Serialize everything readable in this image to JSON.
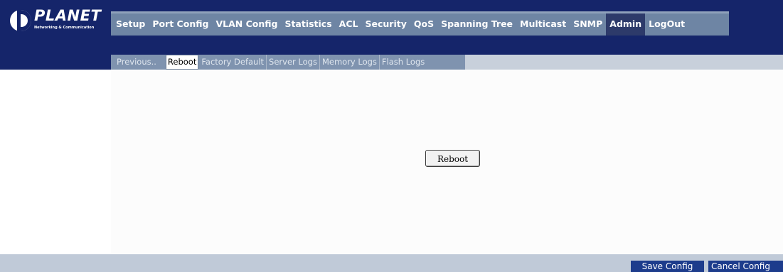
{
  "brand": {
    "name": "PLANET",
    "tagline": "Networking & Communication"
  },
  "menu": {
    "items": [
      {
        "label": "Setup"
      },
      {
        "label": "Port Config"
      },
      {
        "label": "VLAN Config"
      },
      {
        "label": "Statistics"
      },
      {
        "label": "ACL"
      },
      {
        "label": "Security"
      },
      {
        "label": "QoS"
      },
      {
        "label": "Spanning Tree"
      },
      {
        "label": "Multicast"
      },
      {
        "label": "SNMP"
      },
      {
        "label": "Admin",
        "active": true
      },
      {
        "label": "LogOut"
      }
    ]
  },
  "submenu": {
    "items": [
      {
        "label": "Previous.."
      },
      {
        "label": "Reboot",
        "active": true
      },
      {
        "label": "Factory Default"
      },
      {
        "label": "Server Logs"
      },
      {
        "label": "Memory Logs"
      },
      {
        "label": "Flash Logs"
      }
    ]
  },
  "main": {
    "reboot_button": "Reboot"
  },
  "footer": {
    "save_label": "Save Config",
    "cancel_label": "Cancel Config"
  },
  "colors": {
    "header_bg": "#15256a",
    "menu_bg": "#6e85a4",
    "menu_active_bg": "#2d3a6a",
    "footer_bg": "#c0cad8",
    "footer_button_bg": "#1d3c8c"
  }
}
